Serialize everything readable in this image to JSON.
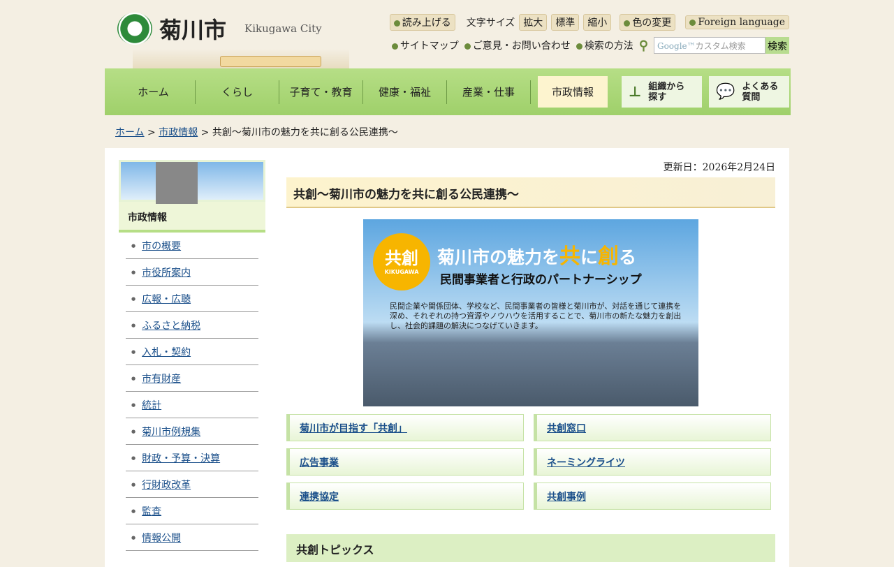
{
  "header": {
    "logo_text": "菊川市",
    "logo_en": "Kikugawa City",
    "read_aloud": "読み上げる",
    "font_size_label": "文字サイズ",
    "font_large": "拡大",
    "font_standard": "標準",
    "font_small": "縮小",
    "color_change": "色の変更",
    "foreign": "Foreign language",
    "sitemap": "サイトマップ",
    "contact": "ご意見・お問い合わせ",
    "search_method": "検索の方法",
    "search_placeholder": "カスタム検索",
    "search_brand": "Google™",
    "search_button": "検索"
  },
  "nav": {
    "items": [
      "ホーム",
      "くらし",
      "子育て・教育",
      "健康・福祉",
      "産業・仕事",
      "市政情報"
    ],
    "org": "組織から\n探す",
    "faq": "よくある\n質問"
  },
  "breadcrumb": {
    "home": "ホーム",
    "sep": " > ",
    "parent": "市政情報",
    "current": "共創～菊川市の魅力を共に創る公民連携～"
  },
  "sidebar": {
    "title": "市政情報",
    "items": [
      "市の概要",
      "市役所案内",
      "広報・広聴",
      "ふるさと納税",
      "入札・契約",
      "市有財産",
      "統計",
      "菊川市例規集",
      "財政・予算・決算",
      "行財政改革",
      "監査",
      "情報公開"
    ]
  },
  "content": {
    "updated": "更新日：2026年2月24日",
    "title": "共創～菊川市の魅力を共に創る公民連携～",
    "banner": {
      "circle": "共創",
      "circle_sub": "KIKUGAWA",
      "headline_a": "菊川市の魅力を",
      "headline_b": "共",
      "headline_c": "に",
      "headline_d": "創",
      "headline_e": "る",
      "sub": "民間事業者と行政のパートナーシップ",
      "body": "民間企業や関係団体、学校など、民間事業者の皆様と菊川市が、対話を通じて連携を深め、それぞれの持つ資源やノウハウを活用することで、菊川市の新たな魅力を創出し、社会的課題の解決につなげていきます。"
    },
    "links": [
      "菊川市が目指す「共創」",
      "共創窓口",
      "広告事業",
      "ネーミングライツ",
      "連携協定",
      "共創事例"
    ],
    "section_title": "共創トピックス"
  }
}
